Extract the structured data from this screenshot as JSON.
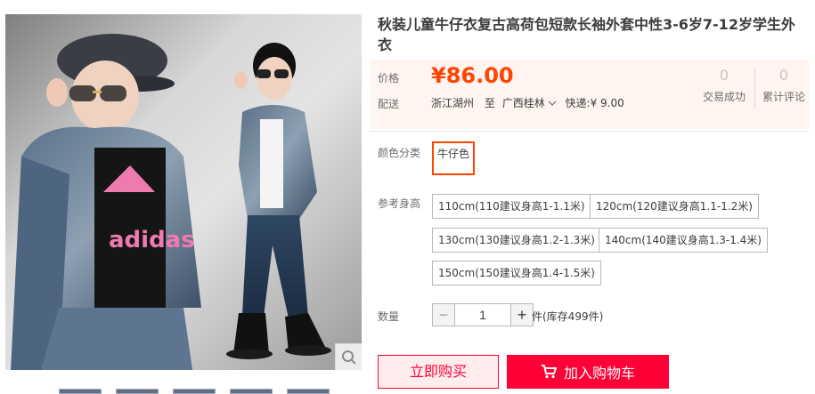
{
  "product": {
    "title": "秋装儿童牛仔衣复古高荷包短款长袖外套中性3-6岁7-12岁学生外衣",
    "photo_logo_text": "adidas"
  },
  "price": {
    "label": "价格",
    "value": "¥86.00"
  },
  "shipping": {
    "label": "配送",
    "from": "浙江湖州",
    "to_prefix": "至",
    "destination": "广西桂林",
    "fee": "快递:¥ 9.00"
  },
  "stats": [
    {
      "count": "0",
      "label": "交易成功"
    },
    {
      "count": "0",
      "label": "累计评论"
    }
  ],
  "color": {
    "label": "颜色分类",
    "options": [
      "牛仔色"
    ]
  },
  "size": {
    "label": "参考身高",
    "options": [
      "110cm(110建议身高1-1.1米)",
      "120cm(120建议身高1.1-1.2米)",
      "130cm(130建议身高1.2-1.3米)",
      "140cm(140建议身高1.3-1.4米)",
      "150cm(150建议身高1.4-1.5米)"
    ]
  },
  "quantity": {
    "label": "数量",
    "value": "1",
    "minus": "−",
    "plus": "+",
    "stock": "件(库存499件)"
  },
  "actions": {
    "buy_now": "立即购买",
    "add_cart": "加入购物车"
  },
  "colors": {
    "accent": "#ff4400",
    "cart": "#ff0036"
  },
  "icons": {
    "zoom": "magnifier-icon",
    "cart": "cart-icon"
  }
}
